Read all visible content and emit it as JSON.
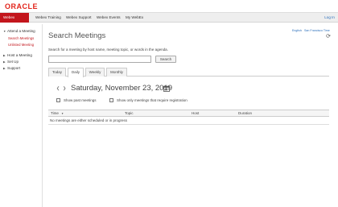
{
  "brand": {
    "logo_text": "ORACLE",
    "accent": "#c3161c"
  },
  "nav": {
    "items": [
      "Webex Meetings",
      "Webex Training",
      "Webex Support",
      "Webex Events",
      "My WebEx"
    ],
    "active_index": 0,
    "login": "Log In"
  },
  "sidebar": {
    "attend": "Attend a Meeting",
    "search_meetings": "Search Meetings",
    "unlisted_meeting": "Unlisted Meeting",
    "host": "Host a Meeting",
    "setup": "Set Up",
    "support": "Support"
  },
  "utility": {
    "language": "English",
    "separator": " : ",
    "timezone": "San Francisco Time"
  },
  "main": {
    "title": "Search Meetings",
    "description": "Search for a meeting by host name, meeting topic, or words in the agenda.",
    "search_placeholder": "",
    "search_button": "Search"
  },
  "tabs": [
    "Today",
    "Daily",
    "Weekly",
    "Monthly"
  ],
  "active_tab": "Daily",
  "date": "Saturday, November 23, 2019",
  "options": {
    "show_past": "Show past meetings",
    "show_registration": "Show only meetings that require registration"
  },
  "table": {
    "columns": [
      "Time",
      "Topic",
      "Host",
      "Duration"
    ],
    "time_sort_indicator": "▼",
    "empty_message": "No meetings are either scheduled or in progress"
  },
  "icons": {
    "refresh": "refresh-icon",
    "calendar": "calendar-icon",
    "prev": "chevron-left-icon",
    "next": "chevron-right-icon"
  }
}
